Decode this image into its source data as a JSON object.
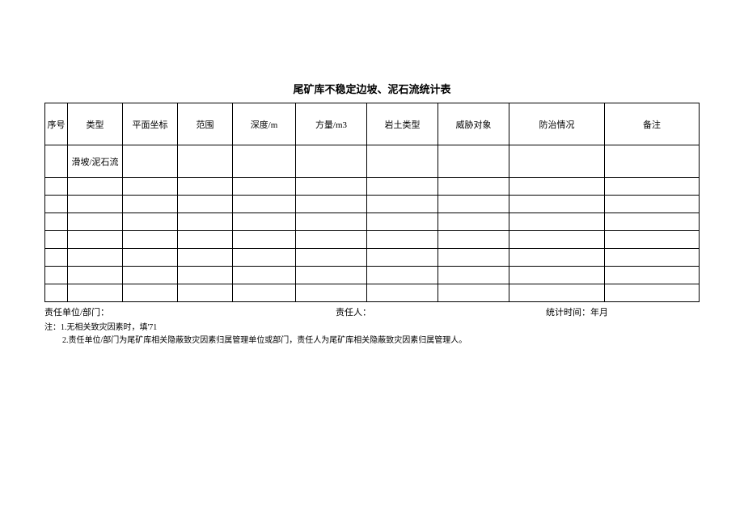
{
  "title": "尾矿库不稳定边坡、泥石流统计表",
  "headers": {
    "seq": "序号",
    "type": "类型",
    "coord": "平面坐标",
    "range": "范围",
    "depth": "深度/m",
    "volume": "方量/m3",
    "rock": "岩土类型",
    "threat": "威胁对象",
    "control": "防治情况",
    "remark": "备注"
  },
  "rows": [
    {
      "seq": "",
      "type": "滑坡/泥石流",
      "coord": "",
      "range": "",
      "depth": "",
      "volume": "",
      "rock": "",
      "threat": "",
      "control": "",
      "remark": ""
    },
    {
      "seq": "",
      "type": "",
      "coord": "",
      "range": "",
      "depth": "",
      "volume": "",
      "rock": "",
      "threat": "",
      "control": "",
      "remark": ""
    },
    {
      "seq": "",
      "type": "",
      "coord": "",
      "range": "",
      "depth": "",
      "volume": "",
      "rock": "",
      "threat": "",
      "control": "",
      "remark": ""
    },
    {
      "seq": "",
      "type": "",
      "coord": "",
      "range": "",
      "depth": "",
      "volume": "",
      "rock": "",
      "threat": "",
      "control": "",
      "remark": ""
    },
    {
      "seq": "",
      "type": "",
      "coord": "",
      "range": "",
      "depth": "",
      "volume": "",
      "rock": "",
      "threat": "",
      "control": "",
      "remark": ""
    },
    {
      "seq": "",
      "type": "",
      "coord": "",
      "range": "",
      "depth": "",
      "volume": "",
      "rock": "",
      "threat": "",
      "control": "",
      "remark": ""
    },
    {
      "seq": "",
      "type": "",
      "coord": "",
      "range": "",
      "depth": "",
      "volume": "",
      "rock": "",
      "threat": "",
      "control": "",
      "remark": ""
    },
    {
      "seq": "",
      "type": "",
      "coord": "",
      "range": "",
      "depth": "",
      "volume": "",
      "rock": "",
      "threat": "",
      "control": "",
      "remark": ""
    }
  ],
  "footer": {
    "unit_label": "责任单位/部门：",
    "person_label": "责任人：",
    "time_label": "统计时间：年月"
  },
  "notes": {
    "line1": "注：1.无相关致灾因素时，填'71",
    "line2": "2.责任单位/部门为尾矿库相关隐蔽致灾因素归属管理单位或部门，责任人为尾矿库相关隐蔽致灾因素归属管理人。"
  }
}
